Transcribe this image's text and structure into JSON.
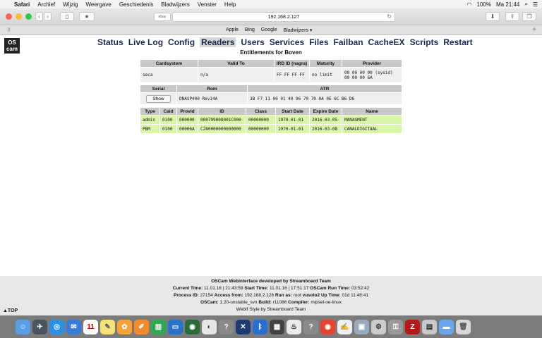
{
  "menubar": {
    "items": [
      "Safari",
      "Archief",
      "Wijzig",
      "Weergave",
      "Geschiedenis",
      "Bladwijzers",
      "Venster",
      "Help"
    ],
    "battery": "100%",
    "clock": "Ma 21:44"
  },
  "toolbar": {
    "url": "192.168.2.127",
    "search_tab": "ebay"
  },
  "favorites": [
    "Apple",
    "Bing",
    "Google",
    "Bladwijzers ▾"
  ],
  "nav": [
    "Status",
    "Live Log",
    "Config",
    "Readers",
    "Users",
    "Services",
    "Files",
    "Failban",
    "CacheEX",
    "Scripts",
    "Restart"
  ],
  "page": {
    "logo_line1": "OS",
    "logo_line2": "cam",
    "heading": "Entitlements for Boven"
  },
  "table1": {
    "headers": [
      "Cardsystem",
      "Valid To",
      "IRD ID (nagra)",
      "Maturity",
      "Provider"
    ],
    "row": [
      "seca",
      "n/a",
      "FF FF FF FF",
      "no limit",
      "00 00 00 00 (sysid) 00 00 00 6A"
    ]
  },
  "table2": {
    "headers": [
      "Serial",
      "Rom",
      "ATR"
    ],
    "show_label": "Show",
    "rom": "DNASP400 Rev14A",
    "atr": "3B F7 11 00 01 40 96 70 70 0A 0E 6C B6 D6"
  },
  "table3": {
    "headers": [
      "Type",
      "Caid",
      "Provid",
      "ID",
      "Class",
      "Start Date",
      "Expire Date",
      "Name"
    ],
    "rows": [
      [
        "admin",
        "0100",
        "000000",
        "000799008001C000",
        "00000000",
        "1970-01-01",
        "2016-03-05",
        "MANAGMENT"
      ],
      [
        "PBM",
        "0100",
        "00006A",
        "C280000000000000",
        "00000000",
        "1970-01-01",
        "2016-03-08",
        "CANALDIGITAAL"
      ]
    ]
  },
  "footer": {
    "line1": "OSCam Webinterface developed by Streamboard Team",
    "ct_label": "Current Time:",
    "ct": "11.01.16 | 21:43:59",
    "st_label": "Start Time:",
    "st": "11.01.16 | 17:51:17",
    "rt_label": "OSCam Run Time:",
    "rt": "03:52:42",
    "pid_label": "Process ID:",
    "pid": "27154",
    "af_label": "Access from:",
    "af": "192.168.2.126",
    "ra_label": "Run as:",
    "ra": "root",
    "host": "vusolo2",
    "ut_label": "Up Time:",
    "ut": "01d 11:48:41",
    "osc_label": "OSCam:",
    "osc": "1.20-unstable_svn",
    "build_label": "Build:",
    "build": "r11086",
    "comp_label": "Compiler:",
    "comp": "mipsel-oe-linux",
    "style": "WebIf Style by Streamboard Team",
    "totop": "▲TOP"
  },
  "dock": [
    "finder-icon",
    "launchpad-icon",
    "safari-icon",
    "mail-icon",
    "calendar-icon",
    "notes-icon",
    "photos-icon",
    "pages-icon",
    "numbers-icon",
    "keynote-icon",
    "maps-icon",
    "app-icon",
    "help-icon",
    "xbmc-icon",
    "bluetooth-icon",
    "calculator-icon",
    "kodi-icon",
    "help2-icon",
    "chrome-icon",
    "textedit-icon",
    "preview-icon",
    "scripts-icon",
    "keychain-icon",
    "filezilla-icon",
    "screenshot-icon",
    "folder-icon",
    "trash-icon"
  ],
  "colors": {
    "green_row": "#d9f5a8",
    "header": "#c8c8c8",
    "cell": "#eeeeee"
  }
}
